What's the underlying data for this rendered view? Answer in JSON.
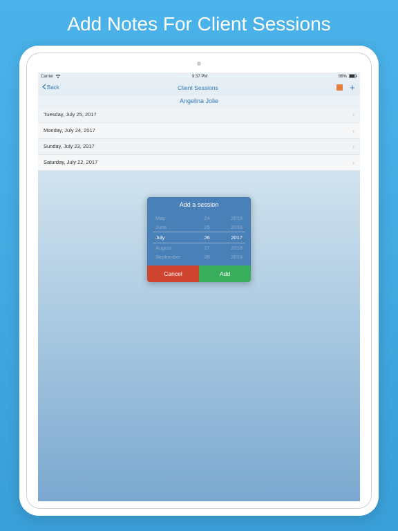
{
  "promo": {
    "title": "Add Notes For Client Sessions"
  },
  "statusBar": {
    "carrier": "Carrier",
    "time": "9:37 PM",
    "battery": "88%"
  },
  "navBar": {
    "back": "Back",
    "title": "Client Sessions"
  },
  "client": {
    "name": "Angelina Jolie"
  },
  "sessions": [
    {
      "date": "Tuesday, July 25, 2017"
    },
    {
      "date": "Monday, July 24, 2017"
    },
    {
      "date": "Sunday, July 23, 2017"
    },
    {
      "date": "Saturday, July 22, 2017"
    }
  ],
  "modal": {
    "title": "Add a session",
    "cancel": "Cancel",
    "add": "Add",
    "picker": {
      "rows": [
        {
          "month": "May",
          "day": "24",
          "year": "2015"
        },
        {
          "month": "June",
          "day": "25",
          "year": "2016"
        },
        {
          "month": "July",
          "day": "26",
          "year": "2017"
        },
        {
          "month": "August",
          "day": "27",
          "year": "2018"
        },
        {
          "month": "September",
          "day": "28",
          "year": "2019"
        }
      ],
      "selectedIndex": 2
    }
  }
}
